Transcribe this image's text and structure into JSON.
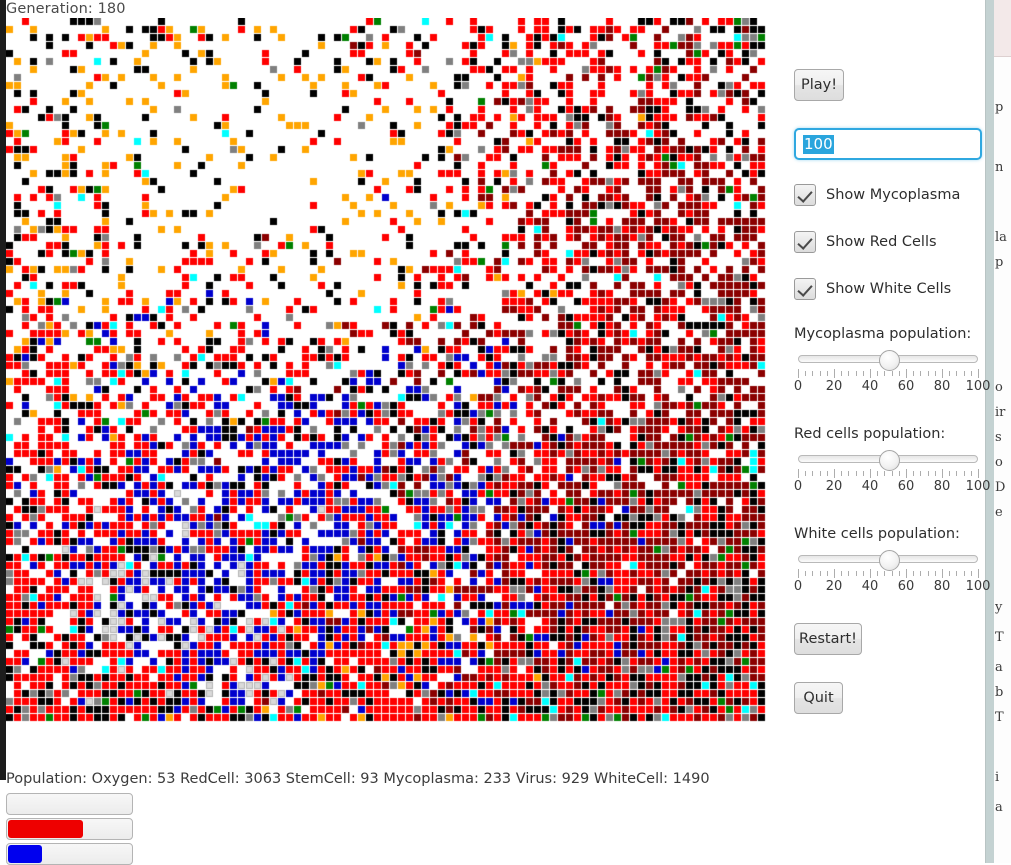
{
  "window": {
    "generation_label": "Generation: 180"
  },
  "controls": {
    "play_label": "Play!",
    "restart_label": "Restart!",
    "quit_label": "Quit",
    "count_input_value": "100",
    "checkboxes": [
      {
        "label": "Show Mycoplasma",
        "checked": true
      },
      {
        "label": "Show Red Cells",
        "checked": true
      },
      {
        "label": "Show White Cells",
        "checked": true
      }
    ],
    "sliders": [
      {
        "title": "Mycoplasma population:",
        "value": 50,
        "min": 0,
        "max": 100,
        "tick_labels": [
          "0",
          "20",
          "40",
          "60",
          "80",
          "100"
        ]
      },
      {
        "title": "Red cells population:",
        "value": 50,
        "min": 0,
        "max": 100,
        "tick_labels": [
          "0",
          "20",
          "40",
          "60",
          "80",
          "100"
        ]
      },
      {
        "title": "White cells population:",
        "value": 50,
        "min": 0,
        "max": 100,
        "tick_labels": [
          "0",
          "20",
          "40",
          "60",
          "80",
          "100"
        ]
      }
    ]
  },
  "status": {
    "population_text": "Population: Oxygen: 53 RedCell: 3063 StemCell: 93 Mycoplasma: 233 Virus: 929 WhiteCell: 1490",
    "counts": {
      "Oxygen": 53,
      "RedCell": 3063,
      "StemCell": 93,
      "Mycoplasma": 233,
      "Virus": 929,
      "WhiteCell": 1490
    },
    "progress_bars": [
      {
        "name": "oxygen-progress",
        "percent": 0,
        "color": "#ffffff"
      },
      {
        "name": "redcell-progress",
        "percent": 60,
        "color": "#ee0000"
      },
      {
        "name": "whitecell-progress",
        "percent": 27,
        "color": "#0000ee"
      }
    ]
  },
  "simulation": {
    "cell_size": 8,
    "cell_draw": 7,
    "cols": 95,
    "rows": 88,
    "background": "#ffffff",
    "palette": {
      "empty": "#ffffff",
      "red": "#ff0000",
      "darkred": "#8b0000",
      "black": "#000000",
      "orange": "#ffa500",
      "green": "#008000",
      "cyan": "#00ffff",
      "blue": "#0000cd",
      "gray": "#808080",
      "lightgray": "#d9d9d9"
    },
    "seed": 180
  },
  "background_window": {
    "text_fragments": [
      "p",
      "n",
      "la",
      "p",
      "o",
      "ir",
      "s",
      "o",
      "D",
      "e",
      "y",
      "T",
      "a",
      "b",
      "T",
      "i",
      "a"
    ]
  }
}
